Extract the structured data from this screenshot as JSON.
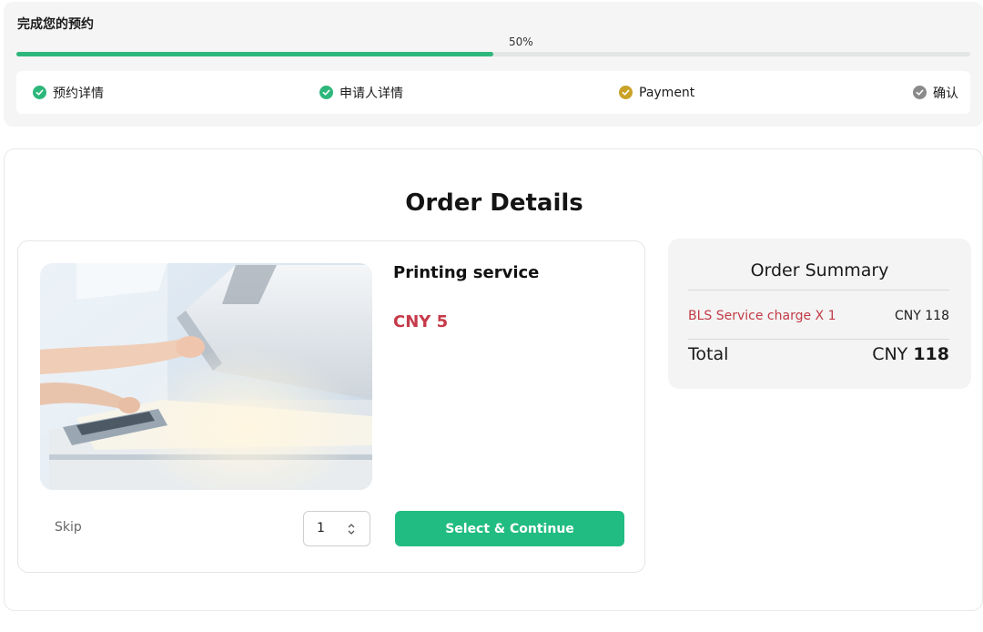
{
  "progress": {
    "title": "完成您的预约",
    "percent_label": "50%",
    "percent": 0.5,
    "steps": [
      {
        "label": "预约详情",
        "status": "complete",
        "icon": "check-circle-icon",
        "color": "#2db77b"
      },
      {
        "label": "申请人详情",
        "status": "complete",
        "icon": "check-circle-icon",
        "color": "#2db77b"
      },
      {
        "label": "Payment",
        "status": "current",
        "icon": "check-circle-icon",
        "color": "#c9a227"
      },
      {
        "label": "确认",
        "status": "pending",
        "icon": "check-circle-icon",
        "color": "#8a8a8a"
      }
    ]
  },
  "order": {
    "heading": "Order Details",
    "product": {
      "name": "Printing service",
      "price": "CNY 5",
      "image": "photocopier-photo"
    },
    "skip_label": "Skip",
    "quantity": "1",
    "select_label": "Select & Continue"
  },
  "summary": {
    "title": "Order Summary",
    "line_label": "BLS Service charge X 1",
    "line_amount": "CNY 118",
    "total_label": "Total",
    "total_currency": "CNY",
    "total_value": "118"
  },
  "colors": {
    "accent_green": "#21bc81",
    "price_red": "#c63a4a",
    "payment_gold": "#c9a227"
  }
}
